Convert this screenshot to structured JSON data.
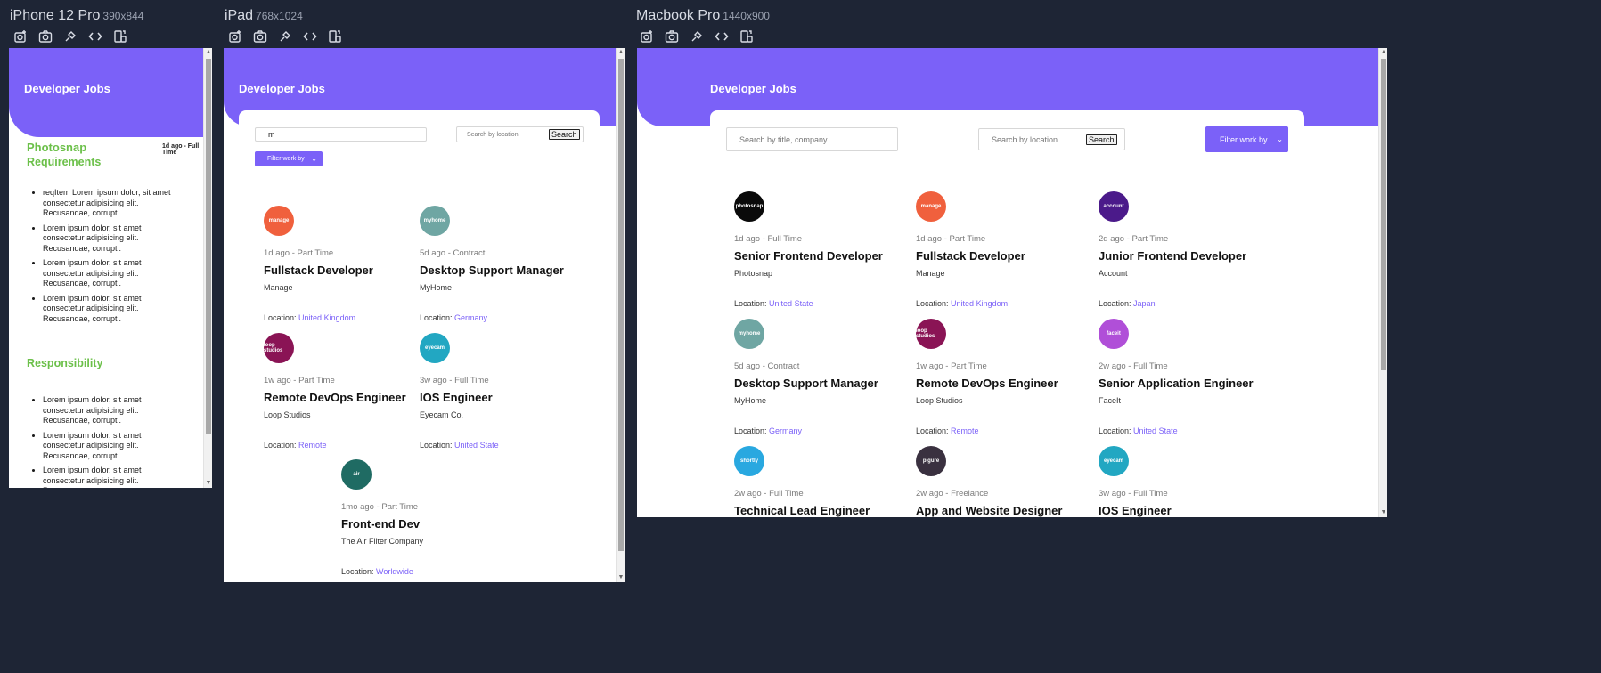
{
  "devices": {
    "phone": {
      "name": "iPhone 12 Pro",
      "dims": "390x844"
    },
    "tablet": {
      "name": "iPad",
      "dims": "768x1024"
    },
    "desktop": {
      "name": "Macbook Pro",
      "dims": "1440x900"
    }
  },
  "app": {
    "title": "Developer Jobs"
  },
  "phone_page": {
    "company": "Photosnap",
    "meta": "1d ago - Full Time",
    "requirements_heading": "Requirements",
    "requirements": [
      "reqItem Lorem ipsum dolor, sit amet consectetur adipisicing elit. Recusandae, corrupti.",
      "Lorem ipsum dolor, sit amet consectetur adipisicing elit. Recusandae, corrupti.",
      "Lorem ipsum dolor, sit amet consectetur adipisicing elit. Recusandae, corrupti.",
      "Lorem ipsum dolor, sit amet consectetur adipisicing elit. Recusandae, corrupti."
    ],
    "responsibility_heading": "Responsibility",
    "responsibilities": [
      "Lorem ipsum dolor, sit amet consectetur adipisicing elit. Recusandae, corrupti.",
      "Lorem ipsum dolor, sit amet consectetur adipisicing elit. Recusandae, corrupti.",
      "Lorem ipsum dolor, sit amet consectetur adipisicing elit. Recusandae, corrupti."
    ]
  },
  "search": {
    "title_value_tablet": "m",
    "title_placeholder": "Search by title, company",
    "location_placeholder": "Search by location",
    "search_label": "Search",
    "filter_label": "Filter work by"
  },
  "location_label": "Location:",
  "tablet_jobs": [
    {
      "logo": "manage",
      "logo_color": "#f0603d",
      "meta": "1d ago - Part Time",
      "title": "Fullstack Developer",
      "company": "Manage",
      "location": "United Kingdom"
    },
    {
      "logo": "myhome",
      "logo_color": "#6fa6a3",
      "meta": "5d ago - Contract",
      "title": "Desktop Support Manager",
      "company": "MyHome",
      "location": "Germany"
    },
    {
      "logo": "loop studios",
      "logo_color": "#8a1455",
      "meta": "1w ago - Part Time",
      "title": "Remote DevOps Engineer",
      "company": "Loop Studios",
      "location": "Remote"
    },
    {
      "logo": "eyecam",
      "logo_color": "#22a7c2",
      "meta": "3w ago - Full Time",
      "title": "IOS Engineer",
      "company": "Eyecam Co.",
      "location": "United State"
    },
    {
      "logo": "air",
      "logo_color": "#1f6b63",
      "meta": "1mo ago - Part Time",
      "title": "Front-end Dev",
      "company": "The Air Filter Company",
      "location": "Worldwide"
    }
  ],
  "desktop_jobs": [
    {
      "logo": "photosnap",
      "logo_color": "#0a0a0a",
      "meta": "1d ago - Full Time",
      "title": "Senior Frontend Developer",
      "company": "Photosnap",
      "location": "United State"
    },
    {
      "logo": "manage",
      "logo_color": "#f0603d",
      "meta": "1d ago - Part Time",
      "title": "Fullstack Developer",
      "company": "Manage",
      "location": "United Kingdom"
    },
    {
      "logo": "account",
      "logo_color": "#4b1a8a",
      "meta": "2d ago - Part Time",
      "title": "Junior Frontend Developer",
      "company": "Account",
      "location": "Japan"
    },
    {
      "logo": "myhome",
      "logo_color": "#6fa6a3",
      "meta": "5d ago - Contract",
      "title": "Desktop Support Manager",
      "company": "MyHome",
      "location": "Germany"
    },
    {
      "logo": "loop studios",
      "logo_color": "#8a1455",
      "meta": "1w ago - Part Time",
      "title": "Remote DevOps Engineer",
      "company": "Loop Studios",
      "location": "Remote"
    },
    {
      "logo": "faceit",
      "logo_color": "#b04fd8",
      "meta": "2w ago - Full Time",
      "title": "Senior Application Engineer",
      "company": "FaceIt",
      "location": "United State"
    },
    {
      "logo": "shortly",
      "logo_color": "#29a8e0",
      "meta": "2w ago - Full Time",
      "title": "Technical Lead Engineer",
      "company": "",
      "location": ""
    },
    {
      "logo": "pigure",
      "logo_color": "#3a3140",
      "meta": "2w ago - Freelance",
      "title": "App and Website Designer",
      "company": "",
      "location": ""
    },
    {
      "logo": "eyecam",
      "logo_color": "#22a7c2",
      "meta": "3w ago - Full Time",
      "title": "IOS Engineer",
      "company": "",
      "location": ""
    }
  ],
  "colors": {
    "accent": "#7b61f8",
    "green": "#6cc04a",
    "background": "#1e2535"
  }
}
